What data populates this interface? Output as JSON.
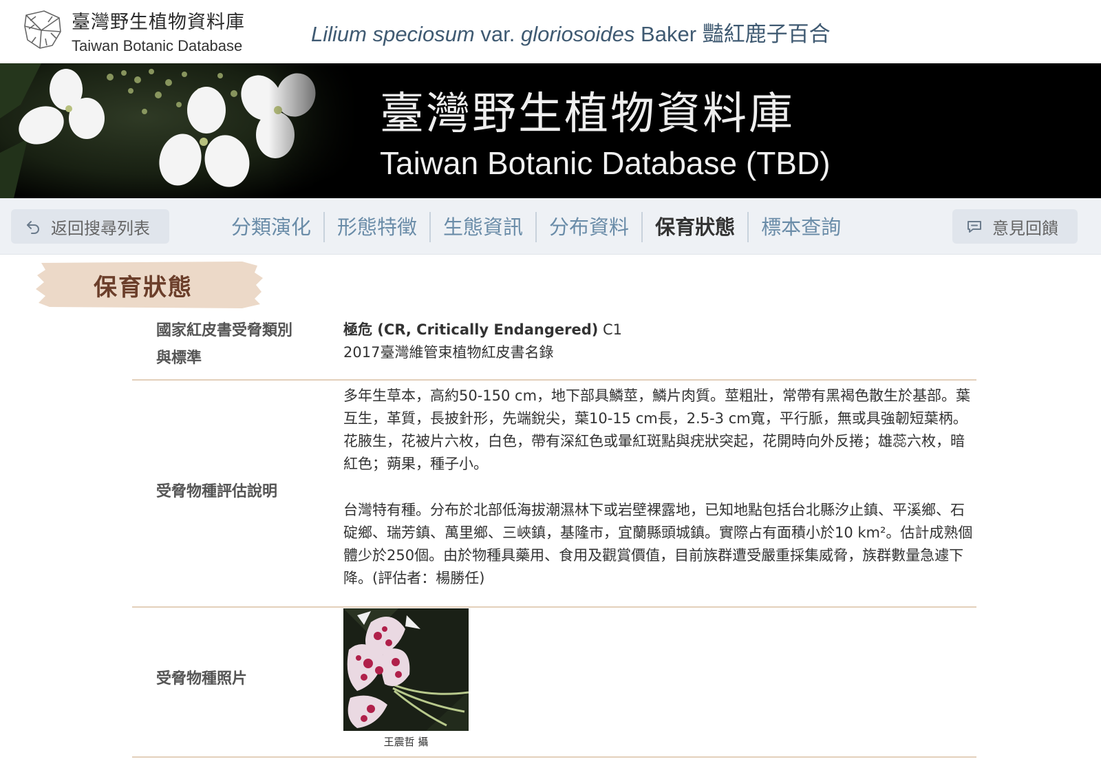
{
  "header": {
    "site_name_zh": "臺灣野生植物資料庫",
    "site_name_en": "Taiwan Botanic Database",
    "species": {
      "genus_species": "Lilium speciosum",
      "rank": "var.",
      "infra_name": "gloriosoides",
      "author": "Baker",
      "common_name_zh": "豔紅鹿子百合"
    }
  },
  "banner": {
    "title_zh": "臺灣野生植物資料庫",
    "title_en": "Taiwan Botanic Database (TBD)"
  },
  "nav": {
    "back_label": "返回搜尋列表",
    "tabs": [
      {
        "label": "分類演化",
        "active": false
      },
      {
        "label": "形態特徵",
        "active": false
      },
      {
        "label": "生態資訊",
        "active": false
      },
      {
        "label": "分布資料",
        "active": false
      },
      {
        "label": "保育狀態",
        "active": true
      },
      {
        "label": "標本查詢",
        "active": false
      }
    ],
    "feedback_label": "意見回饋"
  },
  "section": {
    "title": "保育狀態",
    "rows": [
      {
        "label_line1": "國家紅皮書受脅類別",
        "label_line2": "與標準",
        "category": "極危 (CR, Critically Endangered)",
        "criteria": " C1",
        "source": "2017臺灣維管束植物紅皮書名錄"
      },
      {
        "label": "受脅物種評估說明",
        "para1": "多年生草本，高約50-150 cm，地下部具鱗莖，鱗片肉質。莖粗壯，常帶有黑褐色散生於基部。葉互生，革質，長披針形，先端銳尖，葉10-15 cm長，2.5-3 cm寬，平行脈，無或具強韌短葉柄。花腋生，花被片六枚，白色，帶有深紅色或暈紅斑點與疣狀突起，花開時向外反捲；雄蕊六枚，暗紅色；蒴果，種子小。",
        "para2": "台灣特有種。分布於北部低海拔潮濕林下或岩壁裸露地，已知地點包括台北縣汐止鎮、平溪鄉、石碇鄉、瑞芳鎮、萬里鄉、三峽鎮，基隆市，宜蘭縣頭城鎮。實際占有面積小於10 km²。估計成熟個體少於250個。由於物種具藥用、食用及觀賞價值，目前族群遭受嚴重採集威脅，族群數量急遽下降。(評估者：楊勝任)"
      },
      {
        "label": "受脅物種照片",
        "photo_credit": "王震哲 攝"
      }
    ]
  },
  "colors": {
    "accent_blue": "#6a8ca8",
    "nav_bg": "#eef1f5",
    "row_divider": "#e3cfba",
    "heading_brown": "#6b3e2a"
  }
}
